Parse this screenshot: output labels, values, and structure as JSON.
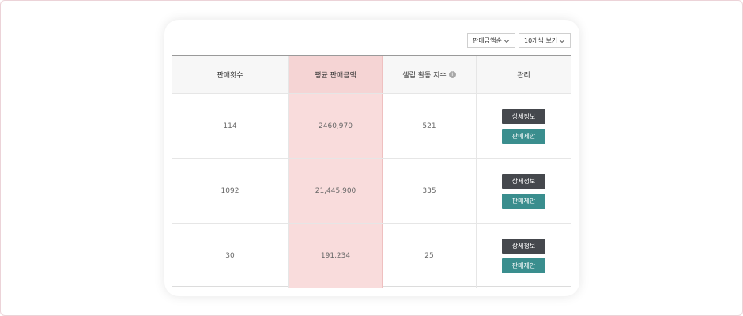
{
  "controls": {
    "sort_select": "판매금액순",
    "view_select": "10개씩 보기"
  },
  "table": {
    "headers": [
      "판매횟수",
      "평균 판매금액",
      "셀럽 활동 지수",
      "관리"
    ],
    "info_glyph": "i",
    "rows": [
      {
        "sales_count": "114",
        "avg_amount": "2460,970",
        "activity_index": "521"
      },
      {
        "sales_count": "1092",
        "avg_amount": "21,445,900",
        "activity_index": "335"
      },
      {
        "sales_count": "30",
        "avg_amount": "191,234",
        "activity_index": "25"
      }
    ],
    "buttons": {
      "detail": "상세정보",
      "suggest": "판매제안"
    }
  },
  "colors": {
    "highlight_column": "#f9dcdc",
    "detail_button": "#45484d",
    "suggest_button": "#3a8e8e"
  },
  "icons": {
    "select_arrow": "chevron-down-icon",
    "header_info": "info-icon"
  }
}
